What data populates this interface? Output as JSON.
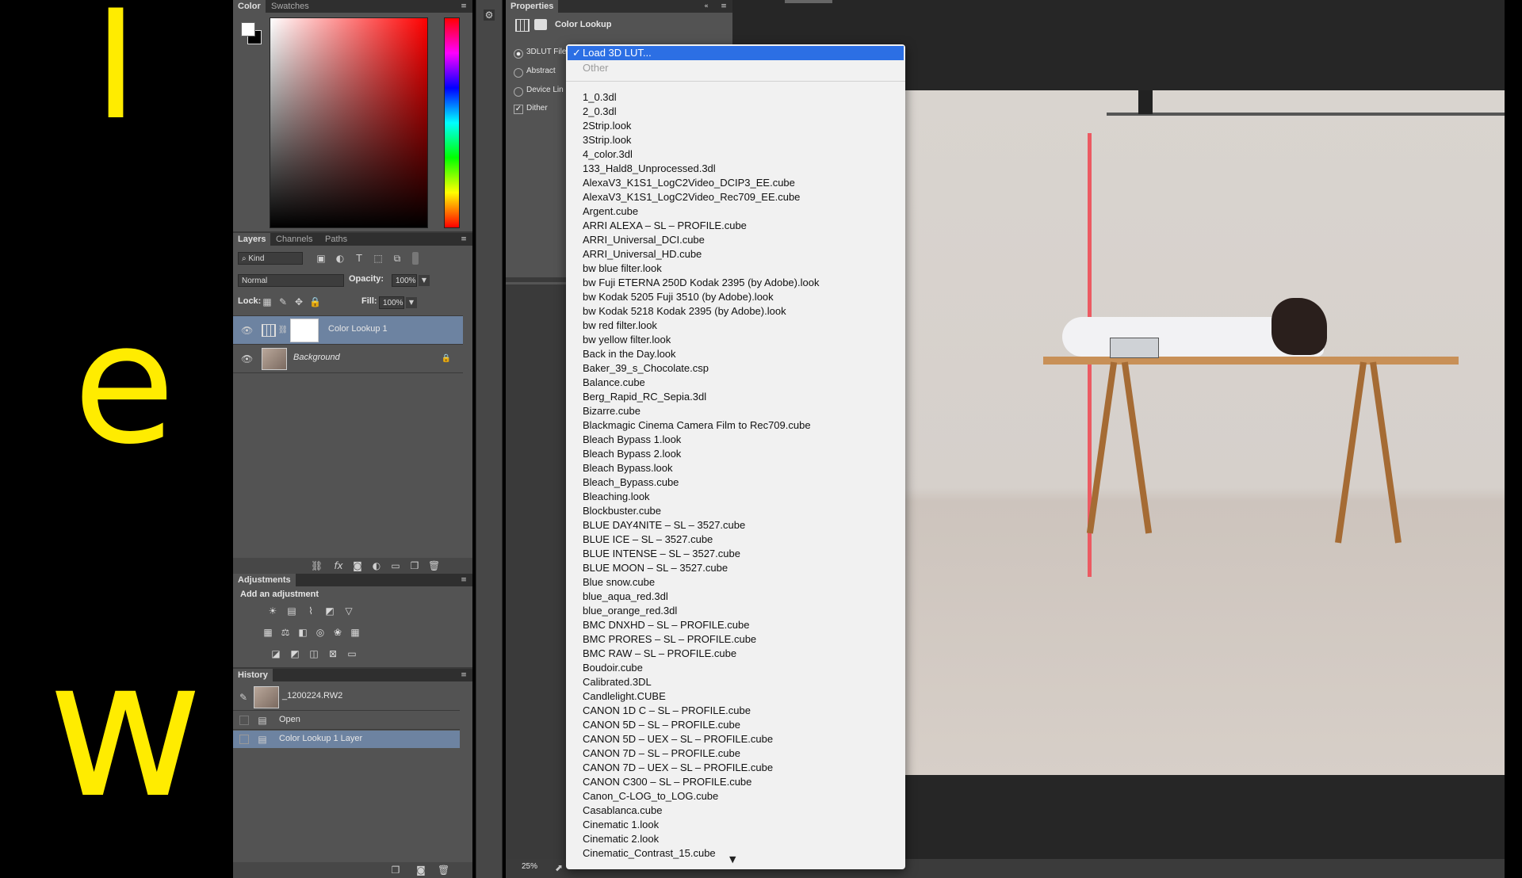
{
  "overlay_letters": [
    "I",
    "e",
    "w"
  ],
  "colors": {
    "accent_yellow": "#ffec00",
    "menu_highlight": "#2c6fe4",
    "panel_bg": "#535353",
    "layer_selected": "#6d83a1"
  },
  "color_panel": {
    "tabs": [
      "Color",
      "Swatches"
    ]
  },
  "layers_panel": {
    "tabs": [
      "Layers",
      "Channels",
      "Paths"
    ],
    "filter_kind": "Kind",
    "blend_mode": "Normal",
    "opacity_label": "Opacity:",
    "opacity_value": "100%",
    "lock_label": "Lock:",
    "fill_label": "Fill:",
    "fill_value": "100%",
    "layers": [
      {
        "name": "Color Lookup 1",
        "selected": true
      },
      {
        "name": "Background",
        "selected": false,
        "locked": true
      }
    ]
  },
  "adjustments_panel": {
    "title": "Adjustments",
    "subtitle": "Add an adjustment"
  },
  "history_panel": {
    "title": "History",
    "snapshot": "_1200224.RW2",
    "items": [
      "Open",
      "Color Lookup 1 Layer"
    ]
  },
  "properties_panel": {
    "title": "Properties",
    "header": "Color Lookup",
    "options": [
      {
        "label": "3DLUT File",
        "type": "radio",
        "checked": true
      },
      {
        "label": "Abstract",
        "type": "radio",
        "checked": false
      },
      {
        "label": "Device Lin",
        "type": "radio",
        "checked": false
      },
      {
        "label": "Dither",
        "type": "checkbox",
        "checked": true
      }
    ]
  },
  "status_bar": {
    "zoom": "25%"
  },
  "lut_menu": {
    "selected": "Load 3D LUT...",
    "selected_mark": "✓",
    "other_label": "Other",
    "scroll_arrow": "▼",
    "items": [
      "1_0.3dl",
      "2_0.3dl",
      "2Strip.look",
      "3Strip.look",
      "4_color.3dl",
      "133_Hald8_Unprocessed.3dl",
      "AlexaV3_K1S1_LogC2Video_DCIP3_EE.cube",
      "AlexaV3_K1S1_LogC2Video_Rec709_EE.cube",
      "Argent.cube",
      "ARRI ALEXA – SL – PROFILE.cube",
      "ARRI_Universal_DCI.cube",
      "ARRI_Universal_HD.cube",
      "bw blue filter.look",
      "bw Fuji ETERNA 250D Kodak 2395 (by Adobe).look",
      "bw Kodak 5205 Fuji 3510 (by Adobe).look",
      "bw Kodak 5218 Kodak 2395 (by Adobe).look",
      "bw red filter.look",
      "bw yellow filter.look",
      "Back in the Day.look",
      "Baker_39_s_Chocolate.csp",
      "Balance.cube",
      "Berg_Rapid_RC_Sepia.3dl",
      "Bizarre.cube",
      "Blackmagic Cinema Camera Film to Rec709.cube",
      "Bleach Bypass 1.look",
      "Bleach Bypass 2.look",
      "Bleach Bypass.look",
      "Bleach_Bypass.cube",
      "Bleaching.look",
      "Blockbuster.cube",
      "BLUE DAY4NITE – SL – 3527.cube",
      "BLUE ICE – SL – 3527.cube",
      "BLUE INTENSE – SL – 3527.cube",
      "BLUE MOON – SL – 3527.cube",
      "Blue snow.cube",
      "blue_aqua_red.3dl",
      "blue_orange_red.3dl",
      "BMC DNXHD – SL – PROFILE.cube",
      "BMC PRORES – SL – PROFILE.cube",
      "BMC RAW – SL – PROFILE.cube",
      "Boudoir.cube",
      "Calibrated.3DL",
      "Candlelight.CUBE",
      "CANON 1D C – SL – PROFILE.cube",
      "CANON 5D – SL – PROFILE.cube",
      "CANON 5D – UEX – SL – PROFILE.cube",
      "CANON 7D – SL – PROFILE.cube",
      "CANON 7D – UEX – SL – PROFILE.cube",
      "CANON C300 – SL – PROFILE.cube",
      "Canon_C-LOG_to_LOG.cube",
      "Casablanca.cube",
      "Cinematic 1.look",
      "Cinematic 2.look",
      "Cinematic_Contrast_15.cube"
    ]
  }
}
